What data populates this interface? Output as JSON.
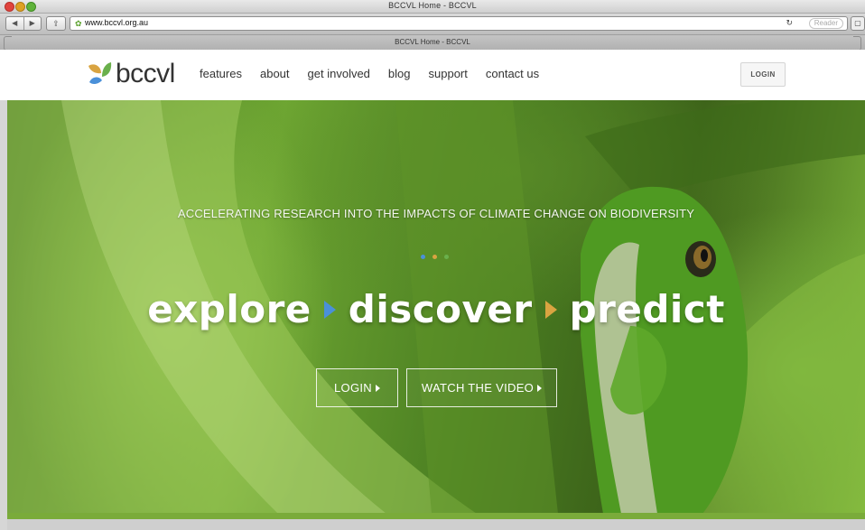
{
  "browser": {
    "window_title": "BCCVL Home - BCCVL",
    "url": "www.bccvl.org.au",
    "reader_label": "Reader",
    "tab_title": "BCCVL Home - BCCVL"
  },
  "site": {
    "logo_text": "bccvl",
    "nav": [
      {
        "label": "features"
      },
      {
        "label": "about"
      },
      {
        "label": "get involved"
      },
      {
        "label": "blog"
      },
      {
        "label": "support"
      },
      {
        "label": "contact us"
      }
    ],
    "login_label": "LOGIN"
  },
  "hero": {
    "tagline": "ACCELERATING RESEARCH INTO THE IMPACTS OF CLIMATE CHANGE ON BIODIVERSITY",
    "headline": [
      "explore",
      "discover",
      "predict"
    ],
    "dot_colors": [
      "#4a90d9",
      "#d9a441",
      "#6ab04c"
    ],
    "buttons": {
      "login": "LOGIN",
      "video": "WATCH THE VIDEO"
    }
  },
  "colors": {
    "accent_blue": "#4a90d9",
    "accent_gold": "#d9a441",
    "brand_green": "#7aab3a"
  }
}
